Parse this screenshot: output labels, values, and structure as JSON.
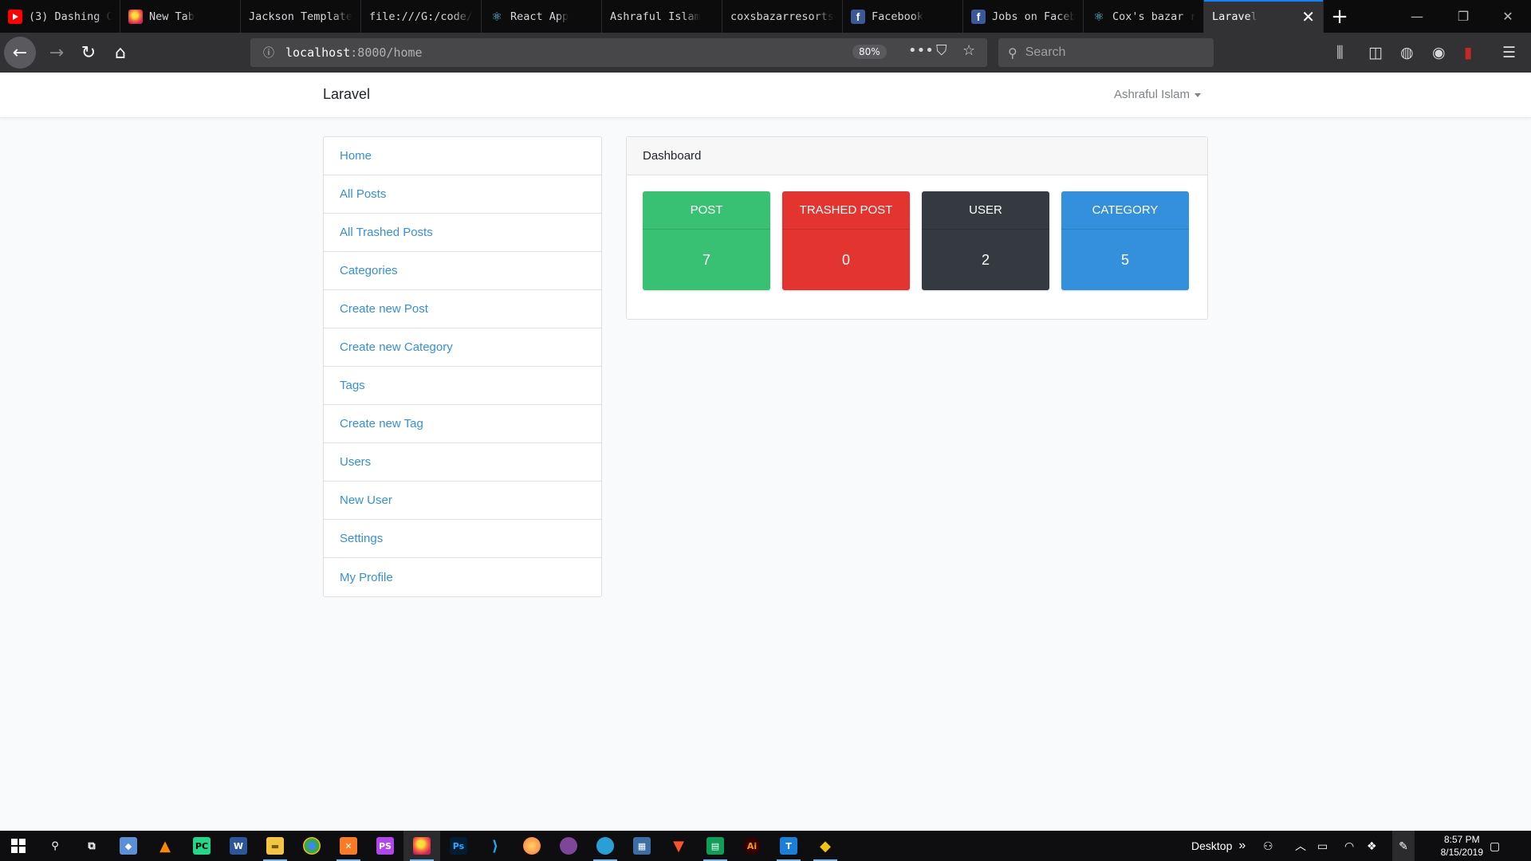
{
  "browser": {
    "tabs": [
      {
        "label": "(3) Dashing C",
        "icon": "youtube-icon"
      },
      {
        "label": "New Tab",
        "icon": "firefox-icon"
      },
      {
        "label": "Jackson Template",
        "icon": ""
      },
      {
        "label": "file:///G:/code/",
        "icon": ""
      },
      {
        "label": "React App",
        "icon": "react-icon"
      },
      {
        "label": "Ashraful Islam",
        "icon": ""
      },
      {
        "label": "coxsbazarresorts",
        "icon": ""
      },
      {
        "label": "Facebook",
        "icon": "facebook-icon"
      },
      {
        "label": "Jobs on Faceb",
        "icon": "facebook-icon"
      },
      {
        "label": "Cox's bazar r",
        "icon": "react-icon"
      }
    ],
    "active_tab": {
      "label": "Laravel"
    },
    "url_host": "localhost",
    "url_path": ":8000/home",
    "zoom": "80%",
    "search_placeholder": "Search"
  },
  "app": {
    "brand": "Laravel",
    "user": "Ashraful Islam",
    "sidebar": [
      {
        "label": "Home"
      },
      {
        "label": "All Posts"
      },
      {
        "label": "All Trashed Posts"
      },
      {
        "label": "Categories"
      },
      {
        "label": "Create new Post"
      },
      {
        "label": "Create new Category"
      },
      {
        "label": "Tags"
      },
      {
        "label": "Create new Tag"
      },
      {
        "label": "Users"
      },
      {
        "label": "New User"
      },
      {
        "label": "Settings"
      },
      {
        "label": "My Profile"
      }
    ],
    "dashboard": {
      "title": "Dashboard",
      "stats": [
        {
          "label": "POST",
          "value": "7",
          "color": "#38c172"
        },
        {
          "label": "TRASHED POST",
          "value": "0",
          "color": "#e3342f"
        },
        {
          "label": "USER",
          "value": "2",
          "color": "#343a40"
        },
        {
          "label": "CATEGORY",
          "value": "5",
          "color": "#3490dc"
        }
      ]
    }
  },
  "taskbar": {
    "desktop_label": "Desktop",
    "time": "8:57 PM",
    "date": "8/15/2019"
  }
}
